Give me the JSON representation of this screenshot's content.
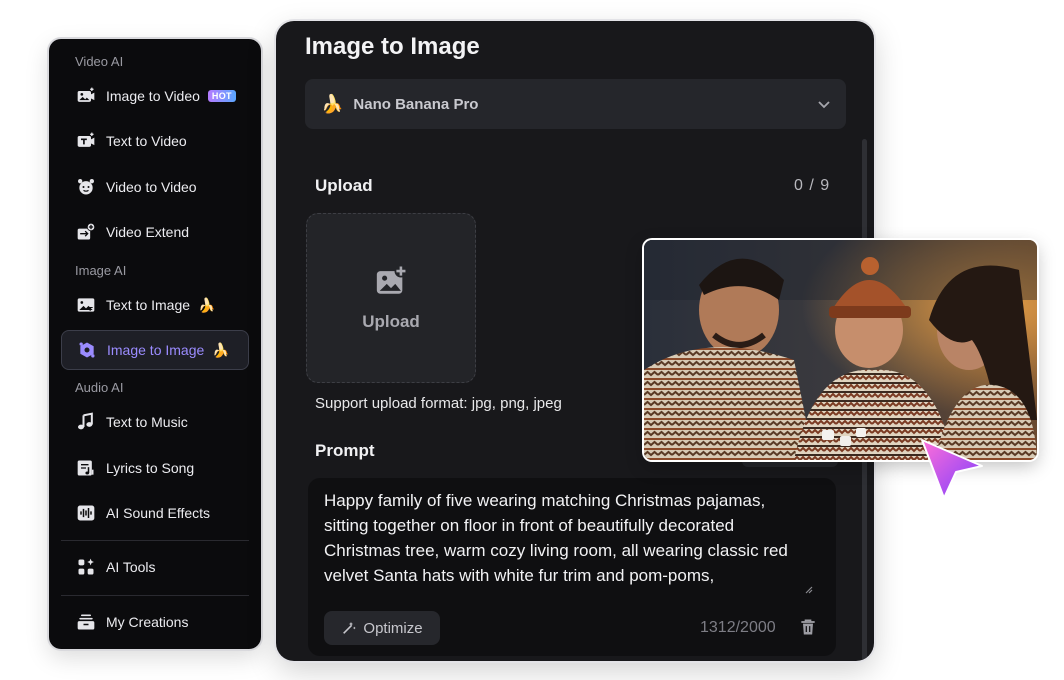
{
  "sidebar": {
    "sections": [
      {
        "title": "Video AI"
      },
      {
        "title": "Image AI"
      },
      {
        "title": "Audio AI"
      }
    ],
    "items": [
      {
        "label": "Image to Video",
        "icon": "image-to-video-icon",
        "badge": "HOT"
      },
      {
        "label": "Text to Video",
        "icon": "text-to-video-icon"
      },
      {
        "label": "Video to Video",
        "icon": "video-to-video-icon"
      },
      {
        "label": "Video Extend",
        "icon": "video-extend-icon"
      },
      {
        "label": "Text to Image",
        "icon": "text-to-image-icon",
        "tag": "🍌"
      },
      {
        "label": "Image to Image",
        "icon": "image-to-image-icon",
        "tag": "🍌",
        "active": true
      },
      {
        "label": "Text to Music",
        "icon": "music-note-icon"
      },
      {
        "label": "Lyrics to Song",
        "icon": "lyrics-icon"
      },
      {
        "label": "AI Sound Effects",
        "icon": "sound-wave-icon"
      },
      {
        "label": "AI Tools",
        "icon": "tools-grid-icon"
      },
      {
        "label": "My Creations",
        "icon": "creations-stack-icon"
      }
    ]
  },
  "main": {
    "title": "Image to Image",
    "model": {
      "emoji": "🍌",
      "name": "Nano Banana Pro"
    },
    "upload": {
      "label": "Upload",
      "count": "0 / 9",
      "button_label": "Upload",
      "support_text": "Support upload format: jpg, png, jpeg"
    },
    "prompt": {
      "label": "Prompt",
      "value": "Happy family of five wearing matching Christmas pajamas, sitting together on floor in front of beautifully decorated Christmas tree, warm cozy living room, all wearing classic red velvet Santa hats with white fur trim and pom-poms,",
      "optimize_label": "Optimize",
      "char_count": "1312/2000"
    }
  },
  "colors": {
    "accent": "#9b8cff",
    "panel_bg": "#18181b",
    "sidebar_bg": "#0b0b0d",
    "cursor_gradient": [
      "#ff6fd8",
      "#7a3cff"
    ]
  }
}
